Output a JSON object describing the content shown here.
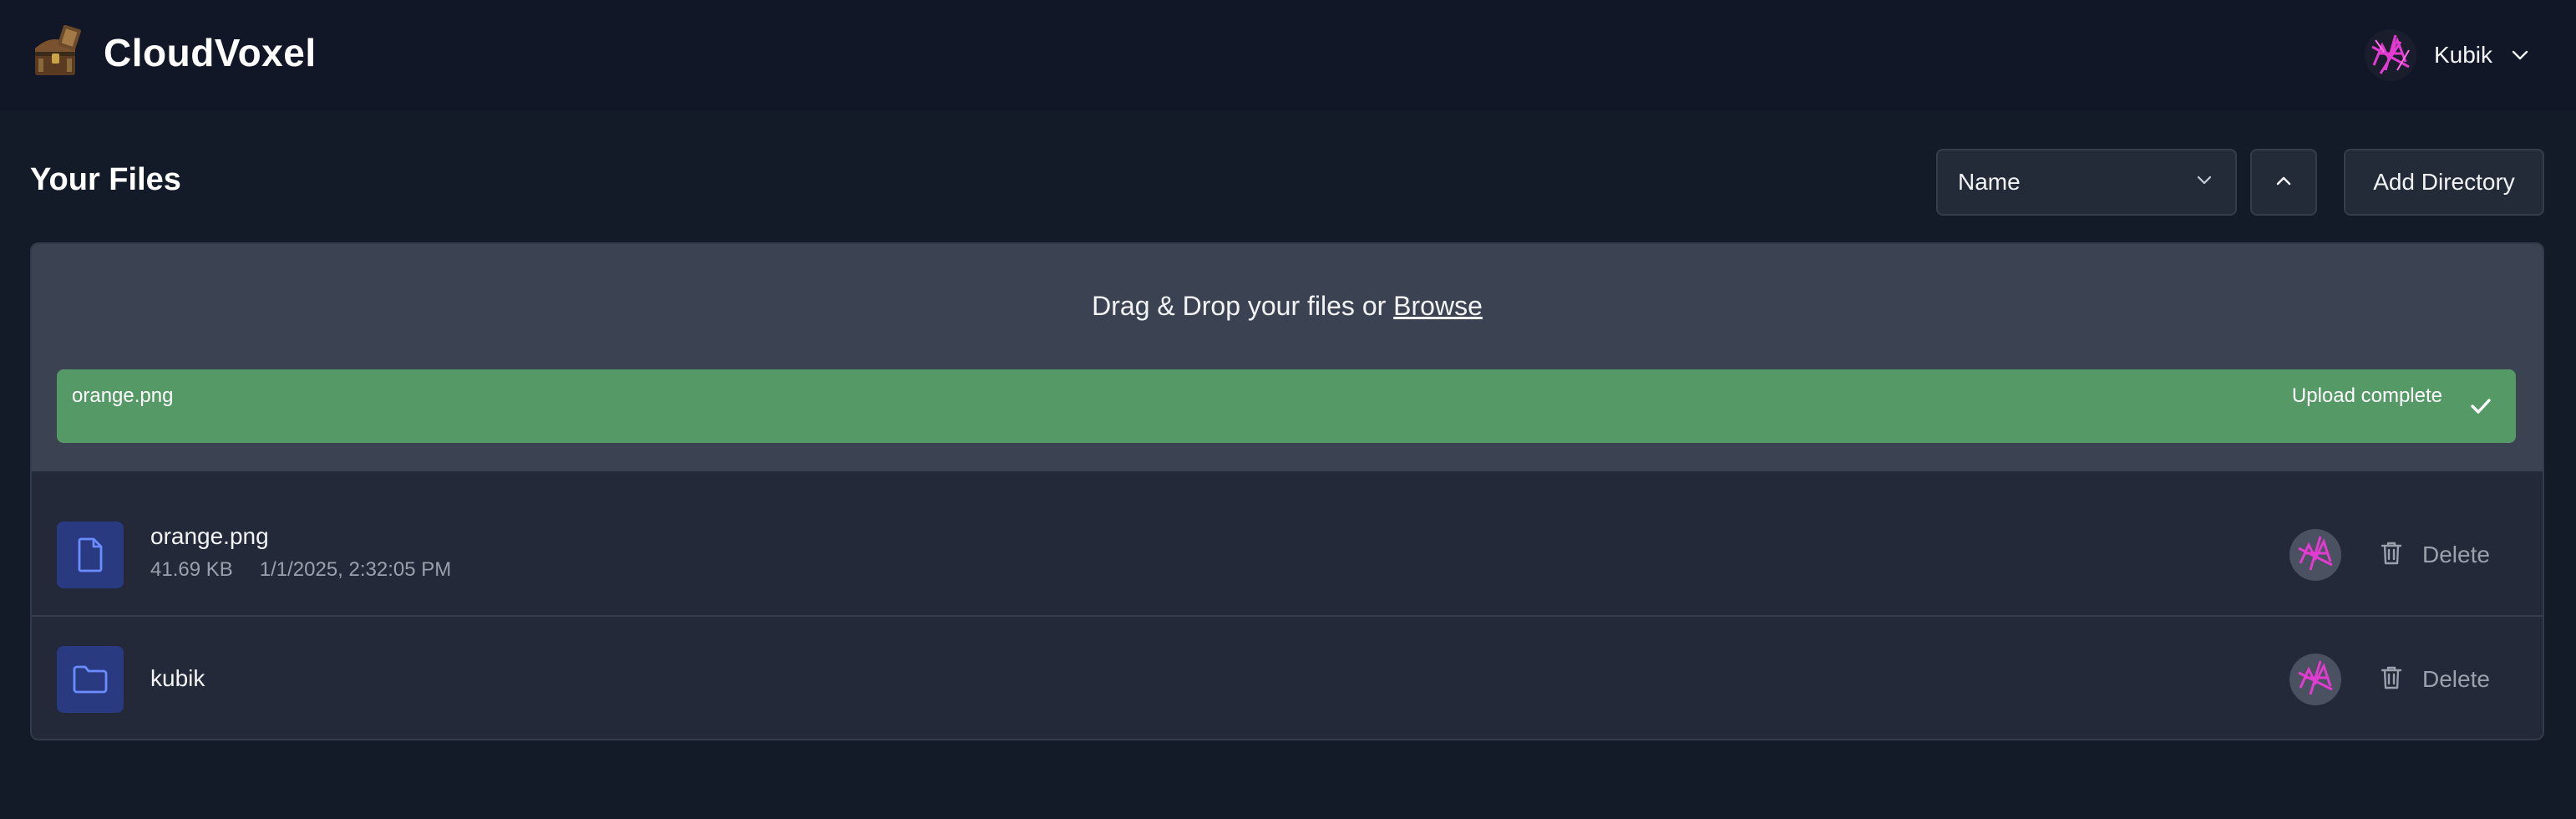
{
  "header": {
    "app_name": "CloudVoxel",
    "user": {
      "name": "Kubik"
    }
  },
  "toolbar": {
    "page_title": "Your Files",
    "sort": {
      "selected": "Name",
      "direction": "ascending"
    },
    "add_directory_label": "Add Directory"
  },
  "dropzone": {
    "text": "Drag & Drop your files or",
    "browse_label": "Browse"
  },
  "upload": {
    "file_name": "orange.png",
    "status": "Upload complete"
  },
  "files": [
    {
      "name": "orange.png",
      "type": "file",
      "size": "41.69 KB",
      "modified": "1/1/2025, 2:32:05 PM",
      "action": "Delete"
    },
    {
      "name": "kubik",
      "type": "folder",
      "action": "Delete"
    }
  ],
  "colors": {
    "background": "#131a28",
    "panel": "#232938",
    "dropzone": "#3b4252",
    "upload_success": "#559966",
    "icon_box": "#293a80",
    "icon_stroke": "#6b8cff",
    "muted_text": "#9aa1ad"
  },
  "icons": {
    "logo": "treasure-chest-icon",
    "user_menu": "chevron-down-icon",
    "sort_select": "chevron-down-icon",
    "sort_direction": "chevron-up-icon",
    "upload_done": "check-icon",
    "file": "file-icon",
    "folder": "folder-icon",
    "delete": "trash-icon"
  }
}
